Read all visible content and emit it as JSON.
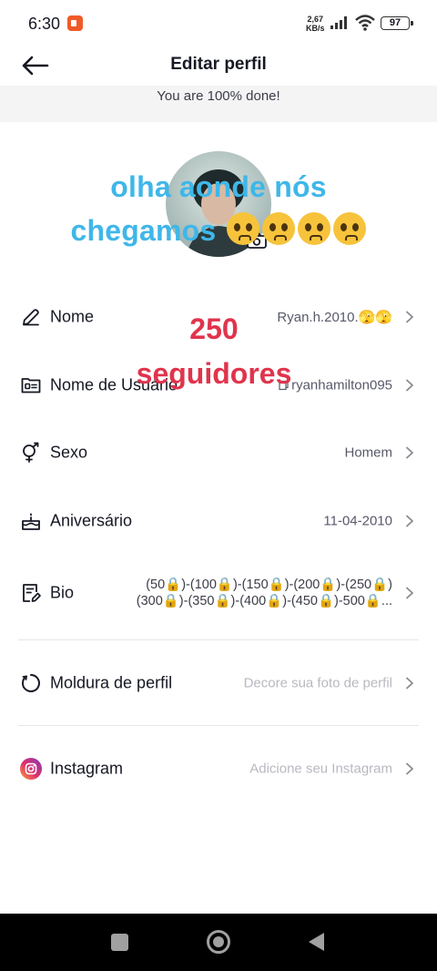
{
  "status_bar": {
    "time": "6:30",
    "net_speed_value": "2,67",
    "net_speed_unit": "KB/s",
    "battery": "97"
  },
  "header": {
    "title": "Editar perfil"
  },
  "progress": {
    "text": "You are 100% done!"
  },
  "overlay": {
    "line1": "olha aonde nós",
    "line2": "chegamos",
    "emoji_count": 4,
    "counter_number": "250",
    "counter_label": "seguidores",
    "blue_color": "#3fb7e8",
    "red_color": "#e0344c"
  },
  "rows": {
    "name": {
      "label": "Nome",
      "value": "Ryan.h.2010.🫣🫣"
    },
    "username": {
      "label": "Nome de Usuário",
      "value": "ryanhamilton095"
    },
    "gender": {
      "label": "Sexo",
      "value": "Homem"
    },
    "birthday": {
      "label": "Aniversário",
      "value": "11-04-2010"
    },
    "bio": {
      "label": "Bio",
      "line1": "(50🔒)-(100🔒)-(150🔒)-(200🔒)-(250🔒)",
      "line2": "(300🔒)-(350🔒)-(400🔒)-(450🔒)-500🔒..."
    },
    "frame": {
      "label": "Moldura de perfil",
      "placeholder": "Decore sua foto de perfil"
    },
    "instagram": {
      "label": "Instagram",
      "placeholder": "Adicione seu Instagram"
    }
  }
}
